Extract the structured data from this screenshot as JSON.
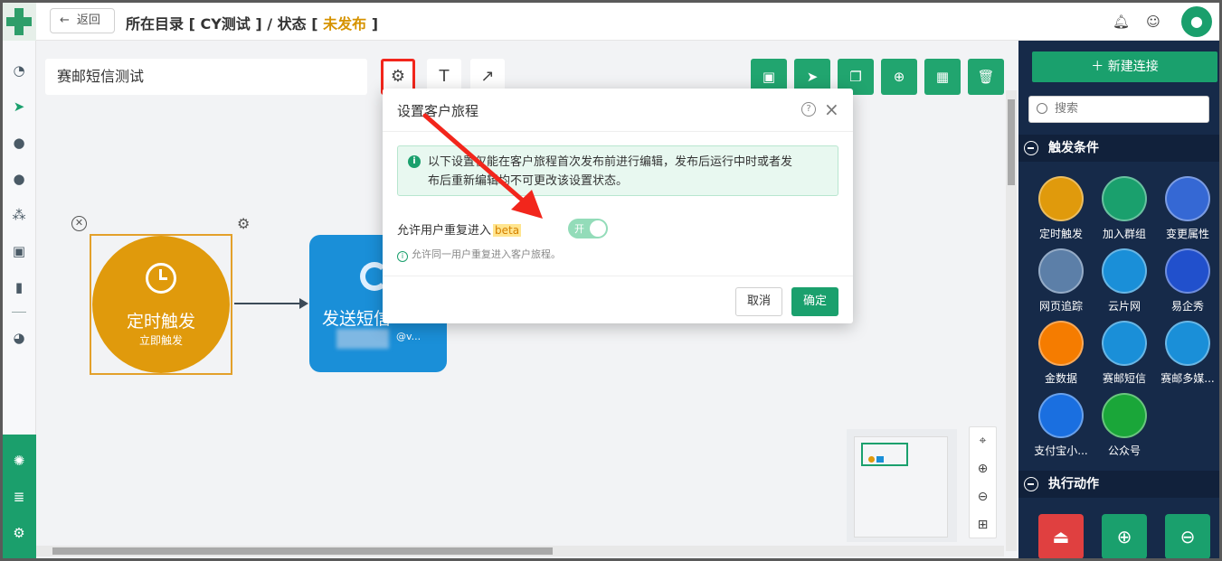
{
  "topbar": {
    "back_label": "返回",
    "crumb_prefix": "所在目录 [ CY测试 ] / 状态 [ ",
    "status": "未发布",
    "crumb_suffix": " ]"
  },
  "canvas": {
    "journey_name": "赛邮短信测试",
    "trigger_node": {
      "title": "定时触发",
      "subtitle": "立即触发"
    },
    "sms_node": {
      "title": "发送短信",
      "subtitle": "@v..."
    }
  },
  "modal": {
    "title": "设置客户旅程",
    "alert_line1": "以下设置仅能在客户旅程首次发布前进行编辑，发布后运行中时或者发",
    "alert_line2": "布后重新编辑均不可更改该设置状态。",
    "option_label": "允许用户重复进入",
    "beta_tag": "beta",
    "switch_text": "开",
    "switch_on": true,
    "hint": "允许同一用户重复进入客户旅程。",
    "cancel": "取消",
    "ok": "确定"
  },
  "right_panel": {
    "new_connection": "新建连接",
    "search_placeholder": "搜索",
    "section_triggers": "触发条件",
    "section_actions": "执行动作",
    "triggers": [
      {
        "label": "定时触发",
        "color": "#e09a0c",
        "icon": "clock-icon"
      },
      {
        "label": "加入群组",
        "color": "#1aa06d",
        "icon": "add-user-icon"
      },
      {
        "label": "变更属性",
        "color": "#3568d4",
        "icon": "edit-icon"
      },
      {
        "label": "网页追踪",
        "color": "#5c7fa8",
        "icon": "web-track-icon"
      },
      {
        "label": "云片网",
        "color": "#1a8fd8",
        "icon": "cloud-icon"
      },
      {
        "label": "易企秀",
        "color": "#2150cc",
        "icon": "infinity-icon"
      },
      {
        "label": "金数据",
        "color": "#f57c00",
        "icon": "leaf-icon"
      },
      {
        "label": "赛邮短信",
        "color": "#1a8fd8",
        "icon": "submail-icon"
      },
      {
        "label": "赛邮多媒...",
        "color": "#1a8fd8",
        "icon": "submail-icon"
      },
      {
        "label": "支付宝小...",
        "color": "#1a6fe0",
        "icon": "alipay-icon"
      },
      {
        "label": "公众号",
        "color": "#1aa639",
        "icon": "wechat-icon"
      }
    ]
  },
  "colors": {
    "brand": "#1aa06d",
    "warning": "#d69300",
    "panel": "#162a49"
  }
}
